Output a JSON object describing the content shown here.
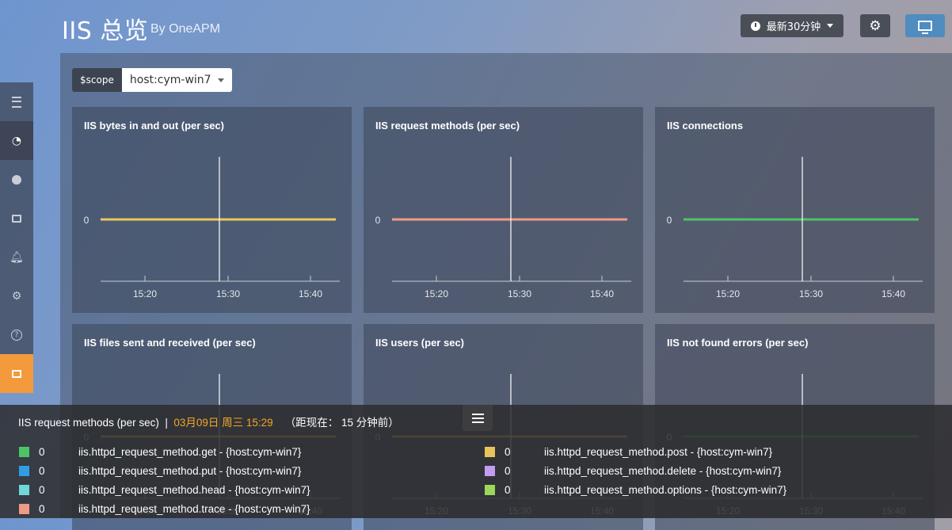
{
  "header": {
    "title": "IIS 总览",
    "subtitle": "By OneAPM",
    "time_range_label": "最新30分钟"
  },
  "scope": {
    "label": "$scope",
    "value": "host:cym-win7"
  },
  "panels": [
    {
      "title": "IIS bytes in and out (per sec)",
      "line_color": "#e8c95a",
      "y_label": "0",
      "x_ticks": [
        "15:20",
        "15:30",
        "15:40"
      ]
    },
    {
      "title": "IIS request methods (per sec)",
      "line_color": "#f09a86",
      "y_label": "0",
      "x_ticks": [
        "15:20",
        "15:30",
        "15:40"
      ]
    },
    {
      "title": "IIS connections",
      "line_color": "#4cc466",
      "y_label": "0",
      "x_ticks": [
        "15:20",
        "15:30",
        "15:40"
      ]
    },
    {
      "title": "IIS files sent and received (per sec)",
      "line_color": "#e8c95a",
      "y_label": "0",
      "x_ticks": [
        "15:20",
        "15:30",
        "15:40"
      ]
    },
    {
      "title": "IIS users (per sec)",
      "line_color": "#e8c95a",
      "y_label": "0",
      "x_ticks": [
        "15:20",
        "15:30",
        "15:40"
      ]
    },
    {
      "title": "IIS not found errors (per sec)",
      "line_color": "#4cc466",
      "y_label": "0",
      "x_ticks": [
        "15:20",
        "15:30",
        "15:40"
      ]
    }
  ],
  "tooltip": {
    "title": "IIS request methods (per sec)",
    "separator": "|",
    "timestamp": "03月09日 周三 15:29",
    "relative": "（距现在： 15 分钟前）",
    "legend": [
      {
        "color": "#4cc466",
        "value": "0",
        "name": "iis.httpd_request_method.get - {host:cym-win7}"
      },
      {
        "color": "#2f9de8",
        "value": "0",
        "name": "iis.httpd_request_method.put - {host:cym-win7}"
      },
      {
        "color": "#6fd8d8",
        "value": "0",
        "name": "iis.httpd_request_method.head - {host:cym-win7}"
      },
      {
        "color": "#f09a86",
        "value": "0",
        "name": "iis.httpd_request_method.trace - {host:cym-win7}"
      },
      {
        "color": "#e8c35a",
        "value": "0",
        "name": "iis.httpd_request_method.post - {host:cym-win7}"
      },
      {
        "color": "#c39cf0",
        "value": "0",
        "name": "iis.httpd_request_method.delete - {host:cym-win7}"
      },
      {
        "color": "#9bd85a",
        "value": "0",
        "name": "iis.httpd_request_method.options - {host:cym-win7}"
      }
    ]
  }
}
